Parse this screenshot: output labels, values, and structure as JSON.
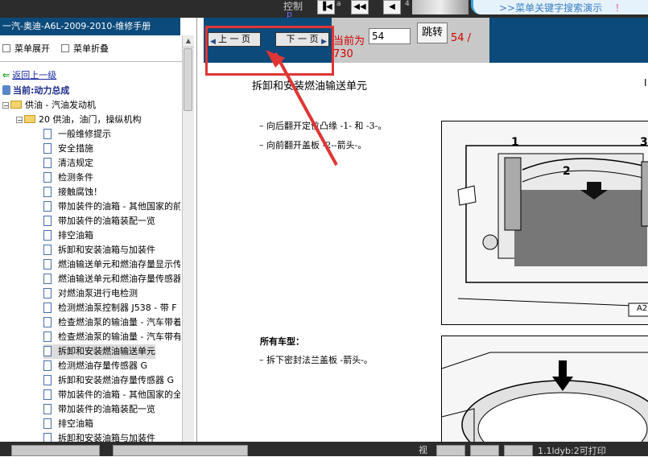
{
  "top": {
    "control_label": "控制",
    "control_label_sub": "p",
    "mini_label_a": "a",
    "mini_label_b": "4",
    "search_demo": ">>菜单关键字搜索演示",
    "search_demo_mark": "！"
  },
  "left": {
    "title": "一汽-奥迪-A6L-2009-2010-维修手册",
    "expand_label": "菜单展开",
    "collapse_label": "菜单折叠",
    "back_label": "返回上一级",
    "current_label": "当前:动力总成",
    "tree": [
      {
        "label": "供油 - 汽油发动机",
        "type": "folder",
        "level": 0
      },
      {
        "label": "20 供油，油门，操纵机构",
        "type": "folder",
        "level": 1
      },
      {
        "label": "一般维修提示",
        "type": "doc"
      },
      {
        "label": "安全措施",
        "type": "doc"
      },
      {
        "label": "清洁规定",
        "type": "doc"
      },
      {
        "label": "检测条件",
        "type": "doc"
      },
      {
        "label": "接触腐蚀！",
        "type": "doc"
      },
      {
        "label": "带加装件的油箱 - 其他国家的前",
        "type": "doc"
      },
      {
        "label": "带加装件的油箱装配一览",
        "type": "doc"
      },
      {
        "label": "排空油箱",
        "type": "doc"
      },
      {
        "label": "拆卸和安装油箱与加装件",
        "type": "doc"
      },
      {
        "label": "燃油输送单元和燃油存量显示传",
        "type": "doc"
      },
      {
        "label": "燃油输送单元和燃油存量传感器",
        "type": "doc"
      },
      {
        "label": "对燃油泵进行电检测",
        "type": "doc"
      },
      {
        "label": "检测燃油泵控制器 J538 - 带 F",
        "type": "doc"
      },
      {
        "label": "检查燃油泵的输油量 - 汽车带着",
        "type": "doc"
      },
      {
        "label": "检查燃油泵的输油量 - 汽车带有",
        "type": "doc"
      },
      {
        "label": "拆卸和安装燃油输送单元",
        "type": "doc",
        "selected": true
      },
      {
        "label": "检测燃油存量传感器 G",
        "type": "doc"
      },
      {
        "label": "拆卸和安装燃油存量传感器 G",
        "type": "doc"
      },
      {
        "label": "带加装件的油箱 - 其他国家的全",
        "type": "doc"
      },
      {
        "label": "带加装件的油箱装配一览",
        "type": "doc"
      },
      {
        "label": "排空油箱",
        "type": "doc"
      },
      {
        "label": "拆卸和安装油箱与加装件",
        "type": "doc"
      }
    ]
  },
  "pager": {
    "prev_label": "上 一 页",
    "next_label": "下 一 页",
    "current_label": "当前为",
    "page_value": "54",
    "go_label": "跳转",
    "page_count": "54 /",
    "page_total": "730"
  },
  "doc": {
    "title": "拆卸和安装燃油输送单元",
    "page_marker": "I",
    "steps_top": [
      "–    向后翻开定位凸缘 -1- 和 -3-。",
      "–    向前翻开盖板 -2--箭头-。"
    ],
    "all_models": "所有车型：",
    "steps_bottom": [
      "–    拆下密封法兰盖板 -箭头-。"
    ],
    "fig1_labels": [
      "1",
      "2",
      "3"
    ],
    "fig1_code": "A2"
  },
  "status": {
    "view_label": "视",
    "print_info": "1.1ldyb:2可打印"
  },
  "colors": {
    "header_blue": "#0b4a7a",
    "annotation_red": "#e03535",
    "page_red": "#d40000"
  }
}
